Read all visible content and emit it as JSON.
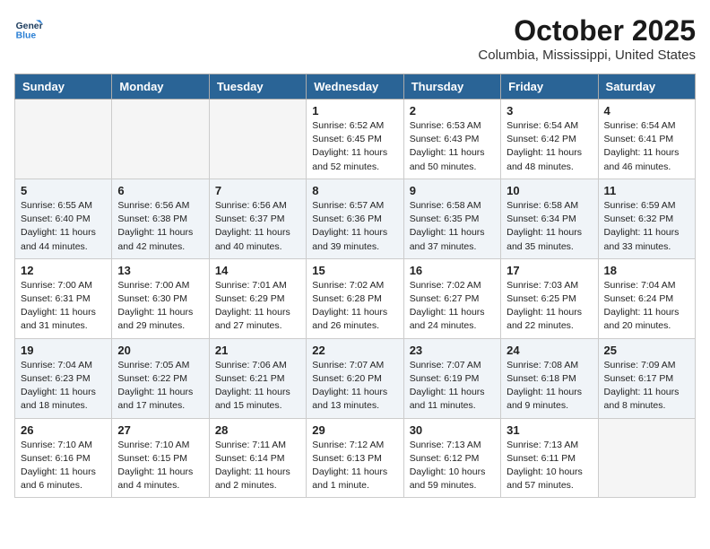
{
  "header": {
    "logo_line1": "General",
    "logo_line2": "Blue",
    "month_title": "October 2025",
    "location": "Columbia, Mississippi, United States"
  },
  "weekdays": [
    "Sunday",
    "Monday",
    "Tuesday",
    "Wednesday",
    "Thursday",
    "Friday",
    "Saturday"
  ],
  "weeks": [
    [
      {
        "num": "",
        "info": ""
      },
      {
        "num": "",
        "info": ""
      },
      {
        "num": "",
        "info": ""
      },
      {
        "num": "1",
        "info": "Sunrise: 6:52 AM\nSunset: 6:45 PM\nDaylight: 11 hours\nand 52 minutes."
      },
      {
        "num": "2",
        "info": "Sunrise: 6:53 AM\nSunset: 6:43 PM\nDaylight: 11 hours\nand 50 minutes."
      },
      {
        "num": "3",
        "info": "Sunrise: 6:54 AM\nSunset: 6:42 PM\nDaylight: 11 hours\nand 48 minutes."
      },
      {
        "num": "4",
        "info": "Sunrise: 6:54 AM\nSunset: 6:41 PM\nDaylight: 11 hours\nand 46 minutes."
      }
    ],
    [
      {
        "num": "5",
        "info": "Sunrise: 6:55 AM\nSunset: 6:40 PM\nDaylight: 11 hours\nand 44 minutes."
      },
      {
        "num": "6",
        "info": "Sunrise: 6:56 AM\nSunset: 6:38 PM\nDaylight: 11 hours\nand 42 minutes."
      },
      {
        "num": "7",
        "info": "Sunrise: 6:56 AM\nSunset: 6:37 PM\nDaylight: 11 hours\nand 40 minutes."
      },
      {
        "num": "8",
        "info": "Sunrise: 6:57 AM\nSunset: 6:36 PM\nDaylight: 11 hours\nand 39 minutes."
      },
      {
        "num": "9",
        "info": "Sunrise: 6:58 AM\nSunset: 6:35 PM\nDaylight: 11 hours\nand 37 minutes."
      },
      {
        "num": "10",
        "info": "Sunrise: 6:58 AM\nSunset: 6:34 PM\nDaylight: 11 hours\nand 35 minutes."
      },
      {
        "num": "11",
        "info": "Sunrise: 6:59 AM\nSunset: 6:32 PM\nDaylight: 11 hours\nand 33 minutes."
      }
    ],
    [
      {
        "num": "12",
        "info": "Sunrise: 7:00 AM\nSunset: 6:31 PM\nDaylight: 11 hours\nand 31 minutes."
      },
      {
        "num": "13",
        "info": "Sunrise: 7:00 AM\nSunset: 6:30 PM\nDaylight: 11 hours\nand 29 minutes."
      },
      {
        "num": "14",
        "info": "Sunrise: 7:01 AM\nSunset: 6:29 PM\nDaylight: 11 hours\nand 27 minutes."
      },
      {
        "num": "15",
        "info": "Sunrise: 7:02 AM\nSunset: 6:28 PM\nDaylight: 11 hours\nand 26 minutes."
      },
      {
        "num": "16",
        "info": "Sunrise: 7:02 AM\nSunset: 6:27 PM\nDaylight: 11 hours\nand 24 minutes."
      },
      {
        "num": "17",
        "info": "Sunrise: 7:03 AM\nSunset: 6:25 PM\nDaylight: 11 hours\nand 22 minutes."
      },
      {
        "num": "18",
        "info": "Sunrise: 7:04 AM\nSunset: 6:24 PM\nDaylight: 11 hours\nand 20 minutes."
      }
    ],
    [
      {
        "num": "19",
        "info": "Sunrise: 7:04 AM\nSunset: 6:23 PM\nDaylight: 11 hours\nand 18 minutes."
      },
      {
        "num": "20",
        "info": "Sunrise: 7:05 AM\nSunset: 6:22 PM\nDaylight: 11 hours\nand 17 minutes."
      },
      {
        "num": "21",
        "info": "Sunrise: 7:06 AM\nSunset: 6:21 PM\nDaylight: 11 hours\nand 15 minutes."
      },
      {
        "num": "22",
        "info": "Sunrise: 7:07 AM\nSunset: 6:20 PM\nDaylight: 11 hours\nand 13 minutes."
      },
      {
        "num": "23",
        "info": "Sunrise: 7:07 AM\nSunset: 6:19 PM\nDaylight: 11 hours\nand 11 minutes."
      },
      {
        "num": "24",
        "info": "Sunrise: 7:08 AM\nSunset: 6:18 PM\nDaylight: 11 hours\nand 9 minutes."
      },
      {
        "num": "25",
        "info": "Sunrise: 7:09 AM\nSunset: 6:17 PM\nDaylight: 11 hours\nand 8 minutes."
      }
    ],
    [
      {
        "num": "26",
        "info": "Sunrise: 7:10 AM\nSunset: 6:16 PM\nDaylight: 11 hours\nand 6 minutes."
      },
      {
        "num": "27",
        "info": "Sunrise: 7:10 AM\nSunset: 6:15 PM\nDaylight: 11 hours\nand 4 minutes."
      },
      {
        "num": "28",
        "info": "Sunrise: 7:11 AM\nSunset: 6:14 PM\nDaylight: 11 hours\nand 2 minutes."
      },
      {
        "num": "29",
        "info": "Sunrise: 7:12 AM\nSunset: 6:13 PM\nDaylight: 11 hours\nand 1 minute."
      },
      {
        "num": "30",
        "info": "Sunrise: 7:13 AM\nSunset: 6:12 PM\nDaylight: 10 hours\nand 59 minutes."
      },
      {
        "num": "31",
        "info": "Sunrise: 7:13 AM\nSunset: 6:11 PM\nDaylight: 10 hours\nand 57 minutes."
      },
      {
        "num": "",
        "info": ""
      }
    ]
  ]
}
